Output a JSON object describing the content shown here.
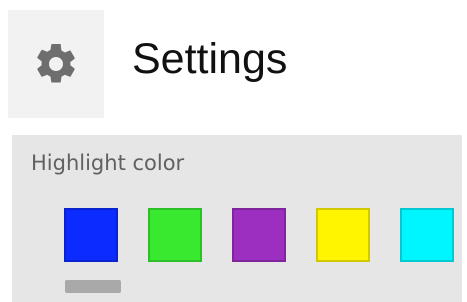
{
  "header": {
    "title": "Settings",
    "icon": "gear-icon"
  },
  "highlight": {
    "label": "Highlight color",
    "selected_index": 0,
    "swatches": [
      {
        "name": "blue",
        "color": "#0b2bff"
      },
      {
        "name": "green",
        "color": "#38e930"
      },
      {
        "name": "purple",
        "color": "#9c2fc0"
      },
      {
        "name": "yellow",
        "color": "#fff500"
      },
      {
        "name": "cyan",
        "color": "#00f6ff"
      }
    ]
  },
  "colors": {
    "panel_background": "#e6e6e6",
    "icon_tile": "#f2f2f2",
    "gear": "#6e6e6e",
    "selection_indicator": "#a9a9a9"
  }
}
